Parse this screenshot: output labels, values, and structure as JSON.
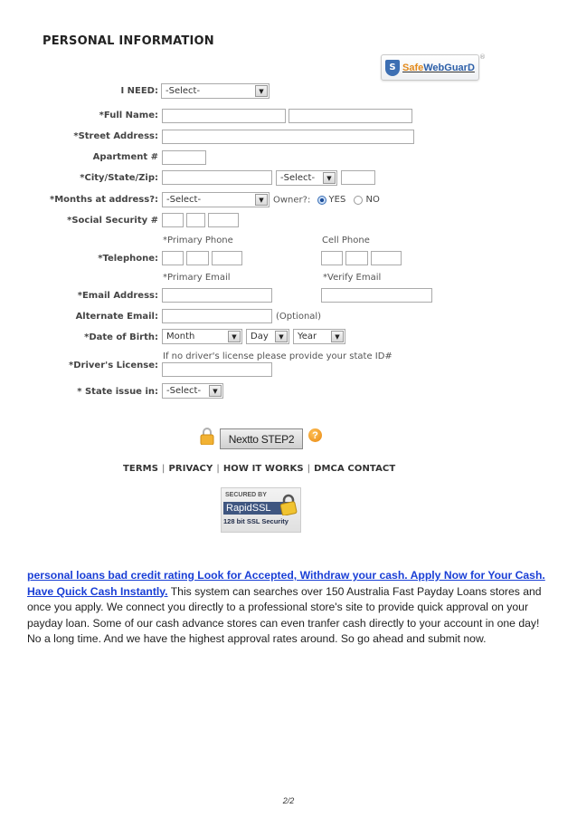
{
  "section_title": "PERSONAL INFORMATION",
  "trust_badge": {
    "shield_letter": "S",
    "brand_safe": "Safe",
    "brand_rest": "WebGuarD",
    "registered": "®"
  },
  "form": {
    "i_need": {
      "label": "I NEED:",
      "value": "-Select-"
    },
    "full_name": {
      "label": "*Full Name:"
    },
    "street_address": {
      "label": "*Street Address:"
    },
    "apartment": {
      "label": "Apartment #"
    },
    "city_state_zip": {
      "label": "*City/State/Zip:",
      "state_value": "-Select-"
    },
    "months_at_address": {
      "label": "*Months at address?:",
      "value": "-Select-",
      "owner_label": "Owner?:",
      "options": [
        {
          "label": "YES",
          "selected": true
        },
        {
          "label": "NO",
          "selected": false
        }
      ]
    },
    "ssn": {
      "label": "*Social Security #"
    },
    "telephone": {
      "label": "*Telephone:",
      "primary_hint": "*Primary Phone",
      "cell_hint": "Cell Phone"
    },
    "email": {
      "label": "*Email Address:",
      "primary_hint": "*Primary Email",
      "verify_hint": "*Verify Email"
    },
    "alternate_email": {
      "label": "Alternate Email:",
      "note": "(Optional)"
    },
    "dob": {
      "label": "*Date of Birth:",
      "month": "Month",
      "day": "Day",
      "year": "Year"
    },
    "drivers_license": {
      "label": "*Driver's License:",
      "hint": "If no driver's license please provide your state ID#"
    },
    "state_issue": {
      "label": "* State issue in:",
      "value": "-Select-"
    }
  },
  "next_button": "Nextto STEP2",
  "help_icon": "?",
  "footer_links": [
    "TERMS",
    "PRIVACY",
    "HOW IT WORKS",
    "DMCA CONTACT"
  ],
  "footer_sep": "|",
  "ssl_badge": {
    "secured_by": "SECURED BY",
    "brand": "RapidSSL",
    "bits": "128 bit SSL Security"
  },
  "article": {
    "link1": "personal loans bad credit rating Look for Accepted, Withdraw your cash. Apply Now for Your Cash.",
    "link2": "Have Quick Cash Instantly.",
    "body": " This system can searches over 150 Australia Fast Payday Loans stores and once you apply. We connect you directly to a professional store's site to provide quick approval on your payday loan. Some of our cash advance stores can even tranfer cash directly to your account in one day! No a long time. And we have the highest approval rates around. So go ahead and submit now."
  },
  "page_number": "2/2"
}
